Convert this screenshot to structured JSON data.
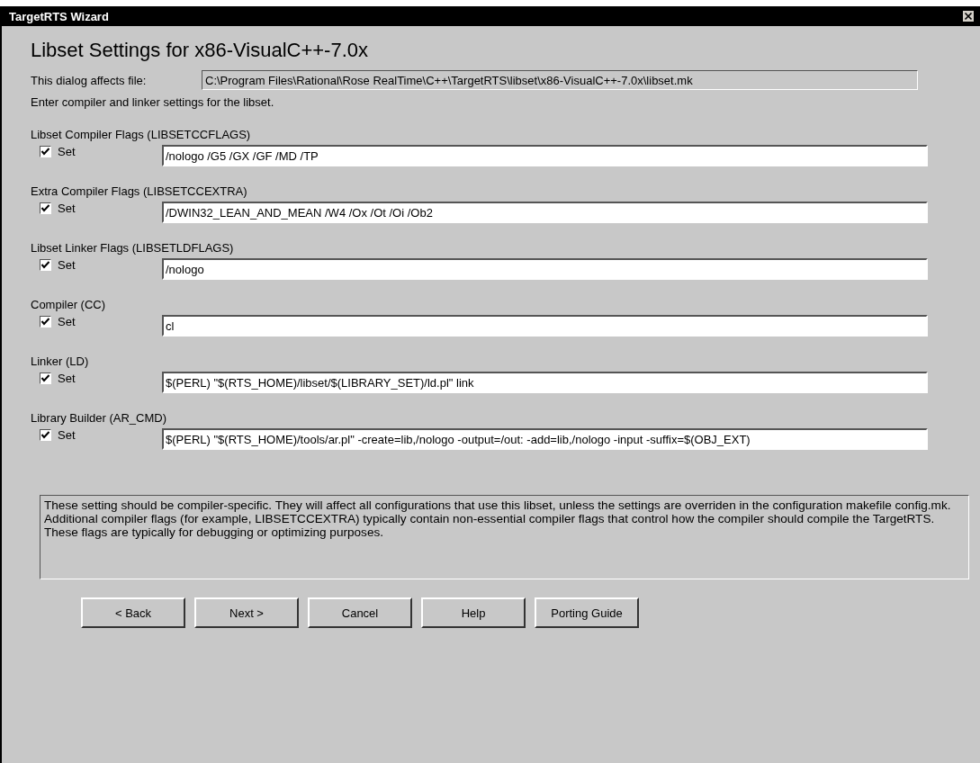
{
  "window": {
    "title": "TargetRTS Wizard"
  },
  "heading": "Libset Settings for x86-VisualC++-7.0x",
  "file": {
    "label": "This dialog affects file:",
    "value": "C:\\Program Files\\Rational\\Rose RealTime\\C++\\TargetRTS\\libset\\x86-VisualC++-7.0x\\libset.mk"
  },
  "intro": "Enter compiler and linker settings for the libset.",
  "settings": [
    {
      "label": "Libset Compiler Flags (LIBSETCCFLAGS)",
      "checkbox": "Set",
      "checked": true,
      "value": "/nologo /G5 /GX /GF /MD /TP"
    },
    {
      "label": "Extra Compiler Flags (LIBSETCCEXTRA)",
      "checkbox": "Set",
      "checked": true,
      "value": "/DWIN32_LEAN_AND_MEAN /W4 /Ox /Ot /Oi /Ob2"
    },
    {
      "label": "Libset Linker Flags (LIBSETLDFLAGS)",
      "checkbox": "Set",
      "checked": true,
      "value": "/nologo"
    },
    {
      "label": "Compiler (CC)",
      "checkbox": "Set",
      "checked": true,
      "value": "cl"
    },
    {
      "label": "Linker (LD)",
      "checkbox": "Set",
      "checked": true,
      "value": "$(PERL) \"$(RTS_HOME)/libset/$(LIBRARY_SET)/ld.pl\" link"
    },
    {
      "label": "Library Builder (AR_CMD)",
      "checkbox": "Set",
      "checked": true,
      "value": "$(PERL) \"$(RTS_HOME)/tools/ar.pl\" -create=lib,/nologo -output=/out: -add=lib,/nologo -input -suffix=$(OBJ_EXT)"
    }
  ],
  "description": "These setting should be compiler-specific. They will affect all configurations that use this libset, unless the settings are overriden in the configuration makefile config.mk. Additional compiler flags (for example, LIBSETCCEXTRA) typically contain non-essential compiler flags that control how the compiler should compile the TargetRTS. These flags are typically for debugging or optimizing purposes.",
  "buttons": [
    "< Back",
    "Next >",
    "Cancel",
    "Help",
    "Porting Guide"
  ]
}
